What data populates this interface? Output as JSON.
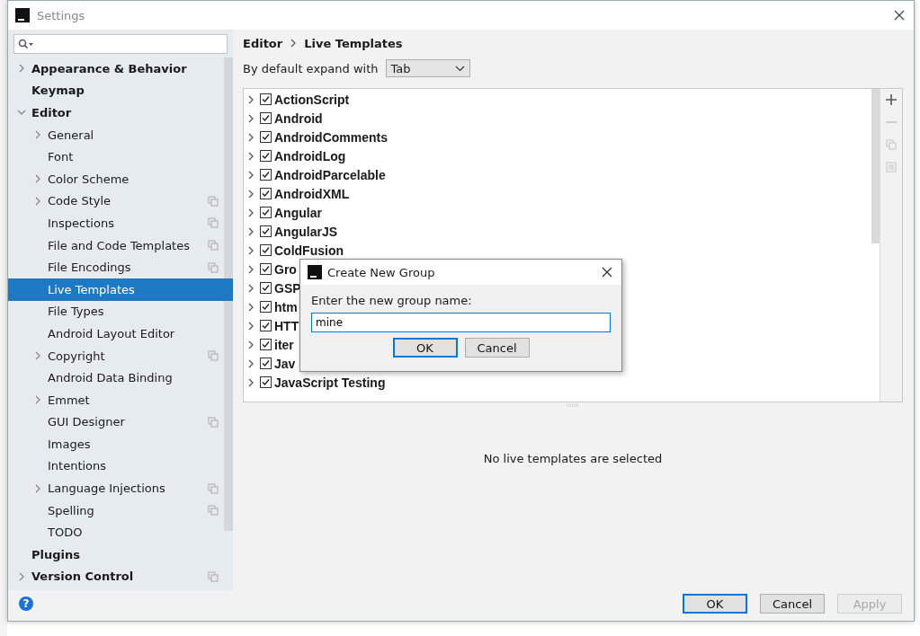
{
  "window": {
    "title": "Settings"
  },
  "sidebar": {
    "items": [
      {
        "label": "Appearance & Behavior",
        "kind": "folder",
        "expanded": false,
        "selected": false,
        "project": false
      },
      {
        "label": "Keymap",
        "kind": "page",
        "selected": false,
        "project": false
      },
      {
        "label": "Editor",
        "kind": "folder",
        "expanded": true,
        "selected": false,
        "project": false,
        "children": [
          {
            "label": "General",
            "kind": "folder",
            "expanded": false,
            "selected": false,
            "project": false
          },
          {
            "label": "Font",
            "kind": "page",
            "selected": false,
            "project": false
          },
          {
            "label": "Color Scheme",
            "kind": "folder",
            "expanded": false,
            "selected": false,
            "project": false
          },
          {
            "label": "Code Style",
            "kind": "folder",
            "expanded": false,
            "selected": false,
            "project": true
          },
          {
            "label": "Inspections",
            "kind": "page",
            "selected": false,
            "project": true
          },
          {
            "label": "File and Code Templates",
            "kind": "page",
            "selected": false,
            "project": true
          },
          {
            "label": "File Encodings",
            "kind": "page",
            "selected": false,
            "project": true
          },
          {
            "label": "Live Templates",
            "kind": "page",
            "selected": true,
            "project": false
          },
          {
            "label": "File Types",
            "kind": "page",
            "selected": false,
            "project": false
          },
          {
            "label": "Android Layout Editor",
            "kind": "page",
            "selected": false,
            "project": false
          },
          {
            "label": "Copyright",
            "kind": "folder",
            "expanded": false,
            "selected": false,
            "project": true
          },
          {
            "label": "Android Data Binding",
            "kind": "page",
            "selected": false,
            "project": false
          },
          {
            "label": "Emmet",
            "kind": "folder",
            "expanded": false,
            "selected": false,
            "project": false
          },
          {
            "label": "GUI Designer",
            "kind": "page",
            "selected": false,
            "project": true
          },
          {
            "label": "Images",
            "kind": "page",
            "selected": false,
            "project": false
          },
          {
            "label": "Intentions",
            "kind": "page",
            "selected": false,
            "project": false
          },
          {
            "label": "Language Injections",
            "kind": "folder",
            "expanded": false,
            "selected": false,
            "project": true
          },
          {
            "label": "Spelling",
            "kind": "page",
            "selected": false,
            "project": true
          },
          {
            "label": "TODO",
            "kind": "page",
            "selected": false,
            "project": false
          }
        ]
      },
      {
        "label": "Plugins",
        "kind": "page",
        "selected": false,
        "project": false
      },
      {
        "label": "Version Control",
        "kind": "folder",
        "expanded": false,
        "selected": false,
        "project": true
      }
    ]
  },
  "breadcrumb": [
    "Editor",
    "Live Templates"
  ],
  "expand": {
    "label": "By default expand with",
    "value": "Tab"
  },
  "groups": [
    {
      "label": "ActionScript",
      "checked": true
    },
    {
      "label": "Android",
      "checked": true
    },
    {
      "label": "AndroidComments",
      "checked": true
    },
    {
      "label": "AndroidLog",
      "checked": true
    },
    {
      "label": "AndroidParcelable",
      "checked": true
    },
    {
      "label": "AndroidXML",
      "checked": true
    },
    {
      "label": "Angular",
      "checked": true
    },
    {
      "label": "AngularJS",
      "checked": true
    },
    {
      "label": "ColdFusion",
      "checked": true
    },
    {
      "label": "Gro",
      "checked": true
    },
    {
      "label": "GSP",
      "checked": true
    },
    {
      "label": "htm",
      "checked": true
    },
    {
      "label": "HTT",
      "checked": true
    },
    {
      "label": "iter",
      "checked": true
    },
    {
      "label": "Jav",
      "checked": true
    },
    {
      "label": "JavaScript Testing",
      "checked": true
    }
  ],
  "toolbar": [
    {
      "kind": "add",
      "disabled": false
    },
    {
      "kind": "remove",
      "disabled": true
    },
    {
      "kind": "copy",
      "disabled": true
    },
    {
      "kind": "list",
      "disabled": true
    }
  ],
  "empty_message": "No live templates are selected",
  "dialog": {
    "title": "Create New Group",
    "prompt": "Enter the new group name:",
    "value": "mine",
    "buttons": [
      "OK",
      "Cancel"
    ]
  },
  "help": "?",
  "buttons": [
    {
      "label": "OK",
      "default": true,
      "disabled": false
    },
    {
      "label": "Cancel",
      "default": false,
      "disabled": false
    },
    {
      "label": "Apply",
      "default": false,
      "disabled": true
    }
  ]
}
